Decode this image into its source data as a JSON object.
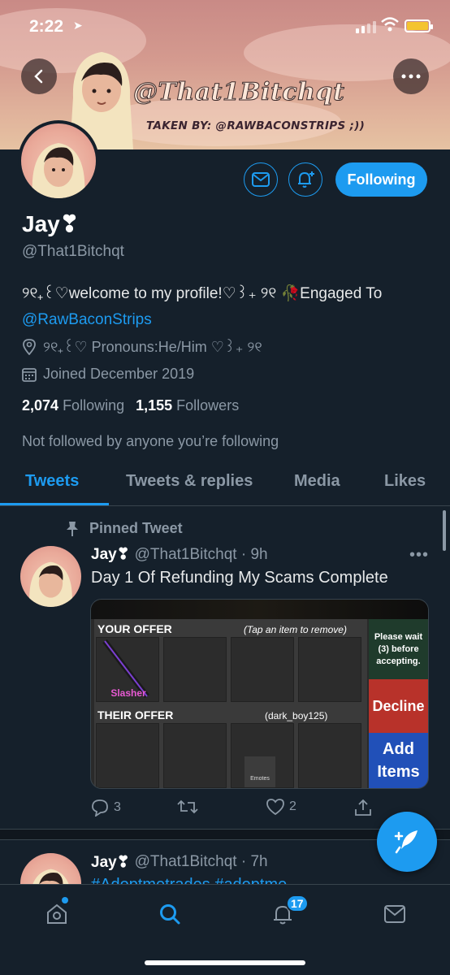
{
  "status_bar": {
    "time": "2:22"
  },
  "banner": {
    "handle_text": "@That1Bitchqt",
    "subtitle_text": "TAKEN BY: @RAWBACONSTRIPS ;))"
  },
  "profile": {
    "display_name": "Jay❣",
    "username": "@That1Bitchqt",
    "bio_text": "୨୧₊꒰♡welcome to my profile!♡꒱₊ ୨୧ 🥀Engaged To ",
    "bio_mention": "@RawBaconStrips",
    "location": "୨୧₊꒰♡ Pronouns:He/Him ♡꒱₊ ୨୧",
    "joined": "Joined December 2019",
    "following_count": "2,074",
    "following_label": "Following",
    "followers_count": "1,155",
    "followers_label": "Followers",
    "not_followed": "Not followed by anyone you’re following",
    "follow_button_label": "Following"
  },
  "tabs": [
    {
      "label": "Tweets",
      "active": true
    },
    {
      "label": "Tweets & replies",
      "active": false
    },
    {
      "label": "Media",
      "active": false
    },
    {
      "label": "Likes",
      "active": false
    }
  ],
  "pinned_tweet": {
    "pinned_label": "Pinned Tweet",
    "name": "Jay❣",
    "handle_time": "@That1Bitchqt · 9h",
    "text": "Day 1 Of Refunding My Scams Complete",
    "trade": {
      "your_offer": "YOUR OFFER",
      "your_hint": "(Tap an item to remove)",
      "item_name": "Slasher",
      "their_offer": "THEIR OFFER",
      "their_user": "(dark_boy125)",
      "slot_label": "Emotes",
      "wait": "Please wait (3) before accepting.",
      "decline": "Decline",
      "add_items": "Add Items"
    },
    "reply_count": "3",
    "like_count": "2"
  },
  "second_tweet": {
    "name": "Jay❣",
    "handle_time": "@That1Bitchqt · 7h",
    "text": "#Adoptmetrades #adoptme"
  },
  "bottom_nav": {
    "notification_badge": "17"
  },
  "colors": {
    "accent": "#1d9bf0",
    "background": "#15202b",
    "muted": "#8b98a5"
  }
}
